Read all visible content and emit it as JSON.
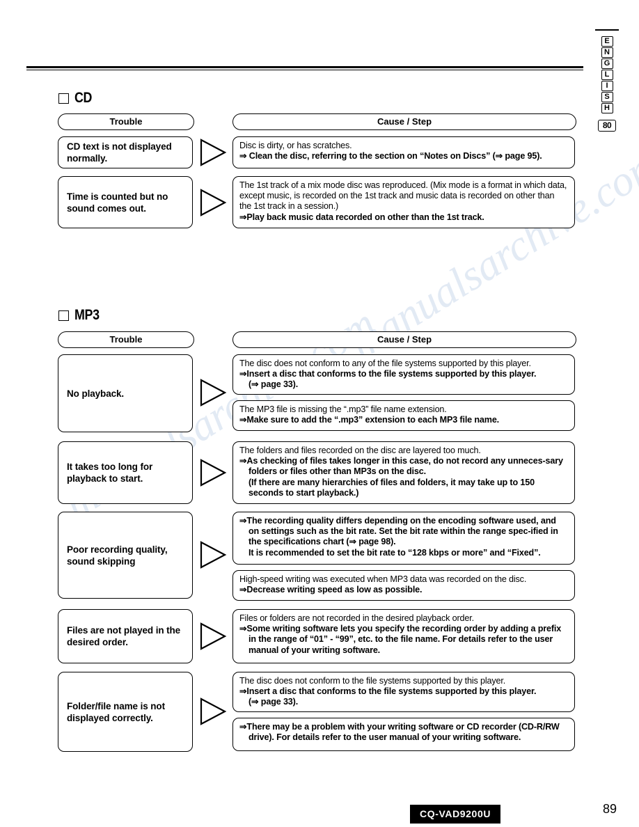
{
  "document": {
    "side_tab": {
      "letters": [
        "E",
        "N",
        "G",
        "L",
        "I",
        "S",
        "H"
      ],
      "number": "80"
    },
    "footer": {
      "model": "CQ-VAD9200U",
      "page_number": "89"
    },
    "watermarks": [
      "manualsarchive.com",
      "manualsarchive.com"
    ]
  },
  "sections": [
    {
      "id": "cd",
      "heading": "CD",
      "col_trouble_label": "Trouble",
      "col_cause_label": "Cause / Step",
      "rows": [
        {
          "trouble": "CD text is not displayed normally.",
          "causes": [
            {
              "lines": [
                {
                  "text": "Disc is dirty, or has scratches.",
                  "style": "plain"
                },
                {
                  "text": "⇒ Clean the disc, referring to the section on “Notes on Discs” (⇒ page 95).",
                  "style": "bold"
                }
              ]
            }
          ]
        },
        {
          "trouble": "Time is counted but no sound comes out.",
          "causes": [
            {
              "lines": [
                {
                  "text": "The 1st track of a mix mode disc was reproduced.  (Mix mode is a format in which data, except music, is recorded on the 1st track and music data is recorded on other than the 1st track in a session.)",
                  "style": "plain"
                },
                {
                  "text": "⇒Play back music data recorded on other than the 1st track.",
                  "style": "bold"
                }
              ]
            }
          ]
        }
      ]
    },
    {
      "id": "mp3",
      "heading": "MP3",
      "col_trouble_label": "Trouble",
      "col_cause_label": "Cause / Step",
      "rows": [
        {
          "trouble": "No playback.",
          "causes": [
            {
              "lines": [
                {
                  "text": "The disc does not conform to any of the file systems supported by this player.",
                  "style": "plain"
                },
                {
                  "text": "⇒Insert a disc that conforms to the file systems supported by this player.",
                  "style": "bold"
                },
                {
                  "text": "(⇒ page 33).",
                  "style": "bold-indent"
                }
              ]
            },
            {
              "lines": [
                {
                  "text": "The MP3 file is missing the “.mp3” file name extension.",
                  "style": "plain"
                },
                {
                  "text": "⇒Make sure to add the “.mp3” extension to each MP3 file name.",
                  "style": "bold"
                }
              ]
            }
          ]
        },
        {
          "trouble": "It takes too long for playback to start.",
          "causes": [
            {
              "lines": [
                {
                  "text": "The folders and files recorded on the disc are layered too much.",
                  "style": "plain"
                },
                {
                  "text": "⇒As checking of files takes longer in this case, do not record any unneces-sary folders or files other than MP3s on the disc.",
                  "style": "bold"
                },
                {
                  "text": "(If there are many hierarchies of files and folders, it may take up to 150 seconds to start playback.)",
                  "style": "bold-indent"
                }
              ]
            }
          ]
        },
        {
          "trouble": "Poor recording quality, sound skipping",
          "causes": [
            {
              "lines": [
                {
                  "text": "⇒The recording quality differs depending on the encoding software used, and on settings such as the bit rate.  Set the bit rate within the range spec-ified in the specifications chart (⇒ page 98).",
                  "style": "bold"
                },
                {
                  "text": "It is recommended to set the bit rate to “128 kbps or more” and “Fixed”.",
                  "style": "bold-indent"
                }
              ]
            },
            {
              "lines": [
                {
                  "text": "High-speed writing was executed when MP3 data was recorded on the disc.",
                  "style": "plain"
                },
                {
                  "text": "⇒Decrease writing speed as low as possible.",
                  "style": "bold"
                }
              ]
            }
          ]
        },
        {
          "trouble": "Files are not played in the desired order.",
          "causes": [
            {
              "lines": [
                {
                  "text": "Files or folders are not recorded in the desired playback order.",
                  "style": "plain"
                },
                {
                  "text": "⇒Some writing software lets you specify the recording order by adding a prefix in the range of “01” - “99”, etc. to the file name.  For details refer to the user manual of your writing software.",
                  "style": "bold"
                }
              ]
            }
          ]
        },
        {
          "trouble": "Folder/file name is not displayed correctly.",
          "causes": [
            {
              "lines": [
                {
                  "text": "The disc does not conform to the file systems supported by this player.",
                  "style": "plain"
                },
                {
                  "text": "⇒Insert a disc that conforms to the file systems supported by this player.",
                  "style": "bold"
                },
                {
                  "text": "(⇒ page 33).",
                  "style": "bold-indent"
                }
              ]
            },
            {
              "lines": [
                {
                  "text": "⇒There may be a problem with your writing software or CD recorder (CD-R/RW drive).  For details refer to the user manual of your writing software.",
                  "style": "bold"
                }
              ]
            }
          ]
        }
      ]
    }
  ]
}
